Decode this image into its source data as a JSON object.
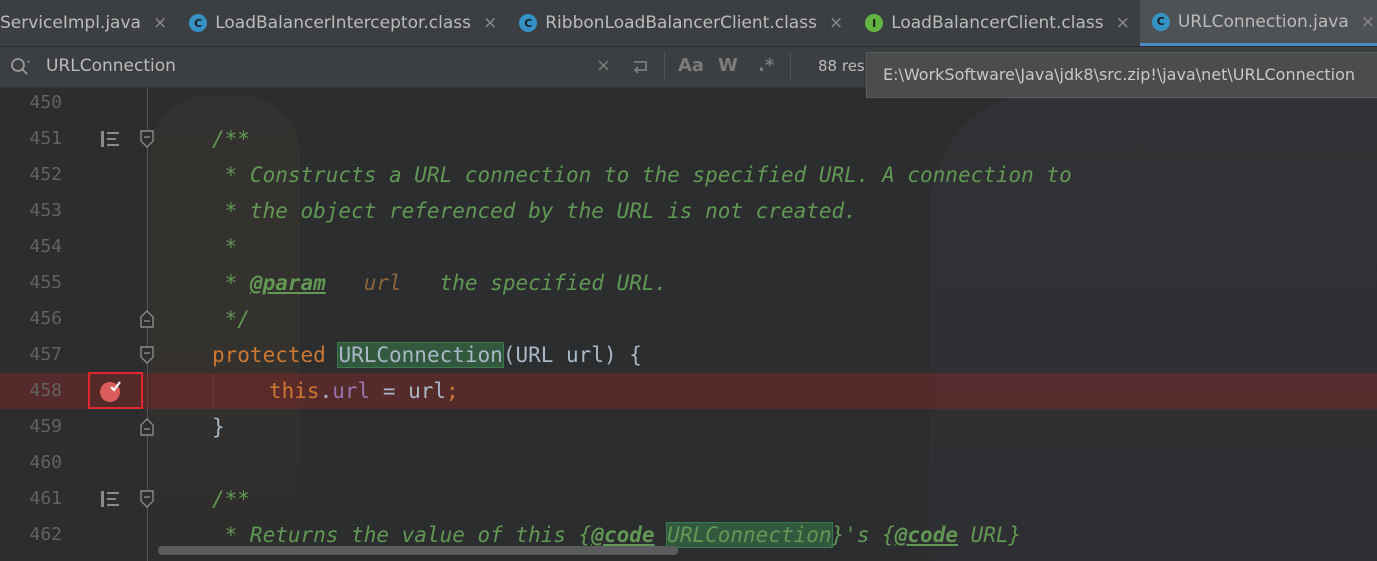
{
  "tabs": [
    {
      "label": "ServiceImpl.java",
      "icon": "none"
    },
    {
      "label": "LoadBalancerInterceptor.class",
      "icon": "class-icon"
    },
    {
      "label": "RibbonLoadBalancerClient.class",
      "icon": "class-icon"
    },
    {
      "label": "LoadBalancerClient.class",
      "icon": "interface-icon"
    },
    {
      "label": "URLConnection.java",
      "icon": "class-icon",
      "active": true
    }
  ],
  "tab_close_glyph": "×",
  "search": {
    "value": "URLConnection",
    "match_case_label": "Aa",
    "words_label": "W",
    "regex_label": ".*",
    "result_count": "88 res"
  },
  "tooltip": "E:\\WorkSoftware\\Java\\jdk8\\src.zip!\\java\\net\\URLConnection",
  "lines": {
    "n450": "450",
    "n451": "451",
    "n452": "452",
    "n453": "453",
    "n454": "454",
    "n455": "455",
    "n456": "456",
    "n457": "457",
    "n458": "458",
    "n459": "459",
    "n460": "460",
    "n461": "461",
    "n462": "462"
  },
  "code": {
    "l451": "/**",
    "l452": " * Constructs a URL connection to the specified URL. A connection to",
    "l453": " * the object referenced by the URL is not created.",
    "l454": " *",
    "l455_star": " * ",
    "l455_tag": "@param",
    "l455_name": "url",
    "l455_rest": "   the specified URL.",
    "l456": " */",
    "l457_kw": "protected",
    "l457_name": "URLConnection",
    "l457_rest": "(URL url) {",
    "l458_this": "this",
    "l458_dot": ".",
    "l458_field": "url",
    "l458_rest": " = url",
    "l458_semi": ";",
    "l459": "}",
    "l461": "/**",
    "l462_a": " * Returns the value of this {",
    "l462_code1": "@code",
    "l462_name": "URLConnection",
    "l462_b": "}'s {",
    "l462_code2": "@code",
    "l462_c": " URL}"
  },
  "colors": {
    "comment": "#629755",
    "keyword": "#cc7832",
    "field": "#9876aa",
    "breakpoint": "#db5c5c",
    "tab_underline": "#4a88c7"
  }
}
